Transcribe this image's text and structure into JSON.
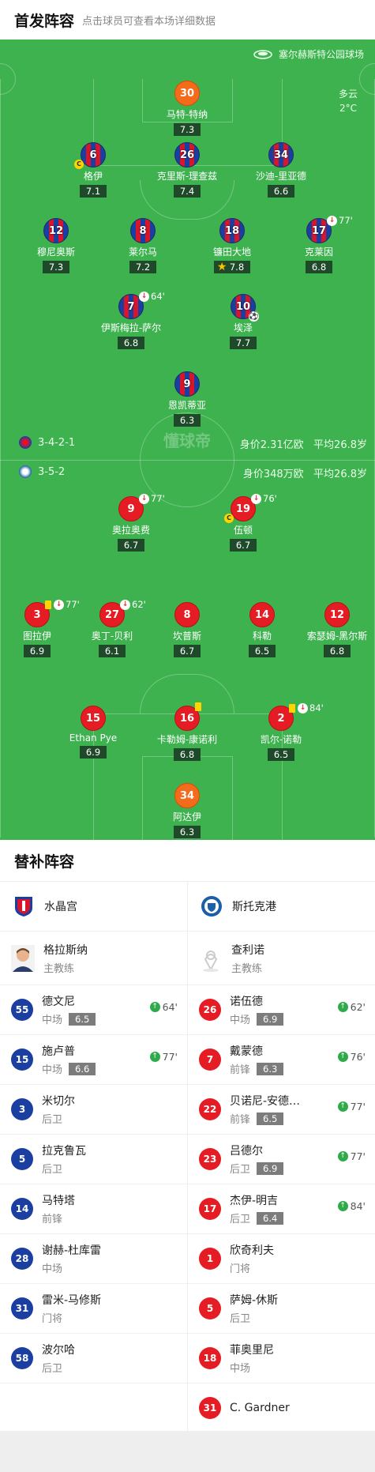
{
  "header": {
    "title": "首发阵容",
    "subtitle": "点击球员可查看本场详细数据"
  },
  "venue": {
    "name": "塞尔赫斯特公园球场"
  },
  "weather": {
    "condition": "多云",
    "temp": "2°C"
  },
  "watermark": "懂球帝",
  "home": {
    "formation": "3-4-2-1",
    "value": "身价2.31亿欧",
    "avg_age": "平均26.8岁"
  },
  "away": {
    "formation": "3-5-2",
    "value": "身价348万欧",
    "avg_age": "平均26.8岁"
  },
  "home_players": [
    {
      "num": "30",
      "name": "马特-特纳",
      "rating": "7.3"
    },
    {
      "num": "6",
      "name": "格伊",
      "rating": "7.1"
    },
    {
      "num": "26",
      "name": "克里斯-理查兹",
      "rating": "7.4"
    },
    {
      "num": "34",
      "name": "沙迪-里亚德",
      "rating": "6.6"
    },
    {
      "num": "12",
      "name": "穆尼奥斯",
      "rating": "7.3"
    },
    {
      "num": "8",
      "name": "莱尔马",
      "rating": "7.2"
    },
    {
      "num": "18",
      "name": "镰田大地",
      "rating": "7.8"
    },
    {
      "num": "17",
      "name": "克莱因",
      "rating": "6.8",
      "sub": "77'"
    },
    {
      "num": "7",
      "name": "伊斯梅拉-萨尔",
      "rating": "6.8",
      "sub": "64'"
    },
    {
      "num": "10",
      "name": "埃泽",
      "rating": "7.7"
    },
    {
      "num": "9",
      "name": "恩凯蒂亚",
      "rating": "6.3"
    }
  ],
  "away_players": [
    {
      "num": "9",
      "name": "奥拉奥费",
      "rating": "6.7",
      "sub": "77'"
    },
    {
      "num": "19",
      "name": "伍顿",
      "rating": "6.7",
      "sub": "76'"
    },
    {
      "num": "3",
      "name": "图拉伊",
      "rating": "6.9",
      "sub": "77'"
    },
    {
      "num": "27",
      "name": "奥丁-贝利",
      "rating": "6.1",
      "sub": "62'"
    },
    {
      "num": "8",
      "name": "坎普斯",
      "rating": "6.7"
    },
    {
      "num": "14",
      "name": "科勒",
      "rating": "6.5"
    },
    {
      "num": "12",
      "name": "索瑟姆-黑尔斯",
      "rating": "6.8"
    },
    {
      "num": "15",
      "name": "Ethan Pye",
      "rating": "6.9"
    },
    {
      "num": "16",
      "name": "卡勒姆-康诺利",
      "rating": "6.8"
    },
    {
      "num": "2",
      "name": "凯尔-诺勒",
      "rating": "6.5",
      "sub": "84'"
    },
    {
      "num": "34",
      "name": "阿达伊",
      "rating": "6.3"
    }
  ],
  "captain_mark": "C",
  "subs_title": "替补阵容",
  "home_team": {
    "name": "水晶宫",
    "coach": "格拉斯纳",
    "coach_role": "主教练"
  },
  "away_team": {
    "name": "斯托克港",
    "coach": "查利诺",
    "coach_role": "主教练"
  },
  "home_subs": [
    {
      "num": "55",
      "name": "德文尼",
      "pos": "中场",
      "rating": "6.5",
      "in": "64'"
    },
    {
      "num": "15",
      "name": "施卢普",
      "pos": "中场",
      "rating": "6.6",
      "in": "77'"
    },
    {
      "num": "3",
      "name": "米切尔",
      "pos": "后卫"
    },
    {
      "num": "5",
      "name": "拉克鲁瓦",
      "pos": "后卫"
    },
    {
      "num": "14",
      "name": "马特塔",
      "pos": "前锋"
    },
    {
      "num": "28",
      "name": "谢赫-杜库雷",
      "pos": "中场"
    },
    {
      "num": "31",
      "name": "雷米-马修斯",
      "pos": "门将"
    },
    {
      "num": "58",
      "name": "波尔哈",
      "pos": "后卫"
    }
  ],
  "away_subs": [
    {
      "num": "26",
      "name": "诺伍德",
      "pos": "中场",
      "rating": "6.9",
      "in": "62'"
    },
    {
      "num": "7",
      "name": "戴蒙德",
      "pos": "前锋",
      "rating": "6.3",
      "in": "76'"
    },
    {
      "num": "22",
      "name": "贝诺尼-安德…",
      "pos": "前锋",
      "rating": "6.5",
      "in": "77'"
    },
    {
      "num": "23",
      "name": "吕德尔",
      "pos": "后卫",
      "rating": "6.9",
      "in": "77'"
    },
    {
      "num": "17",
      "name": "杰伊-明吉",
      "pos": "后卫",
      "rating": "6.4",
      "in": "84'"
    },
    {
      "num": "1",
      "name": "欣奇利夫",
      "pos": "门将"
    },
    {
      "num": "5",
      "name": "萨姆-休斯",
      "pos": "后卫"
    },
    {
      "num": "18",
      "name": "菲奥里尼",
      "pos": "中场"
    },
    {
      "num": "31",
      "name": "C. Gardner"
    }
  ],
  "colors": {
    "pitch": "#3db24f",
    "palace_blue": "#1b3fa0",
    "palace_red": "#d8152b",
    "stockport_red": "#e51c23",
    "keeper_orange": "#f46b1b",
    "sub_in_green": "#2eaa4a"
  },
  "icons": {
    "sub_out": "sub-out-icon",
    "sub_in": "sub-in-icon",
    "captain": "captain-badge",
    "goal": "football-icon",
    "yellow": "yellow-card-icon",
    "star": "star-icon"
  }
}
